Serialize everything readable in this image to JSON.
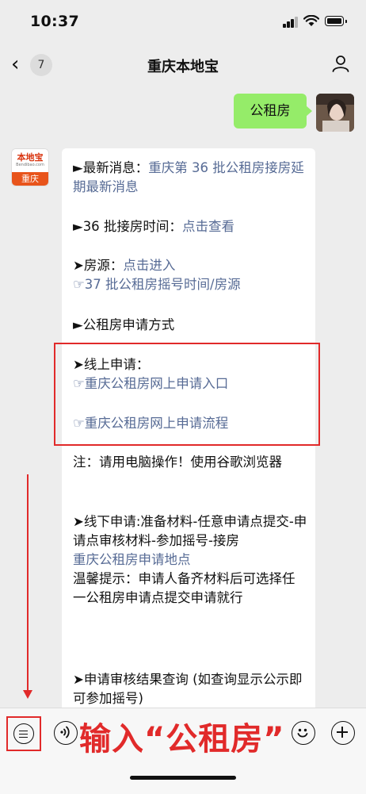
{
  "status": {
    "time": "10:37"
  },
  "nav": {
    "back_count": "7",
    "title": "重庆本地宝"
  },
  "outgoing": {
    "text": "公租房"
  },
  "bot_avatar": {
    "logo": "本地宝",
    "logo_domain": "Bendibao.com",
    "city": "重庆"
  },
  "message": {
    "p1_prefix": "►最新消息：",
    "p1_link": "重庆第 36 批公租房接房延期最新消息",
    "p2_prefix": "►36 批接房时间：",
    "p2_link": "点击查看",
    "p3_prefix": "➤房源：",
    "p3_link": "点击进入",
    "p3_link2": "☞37 批公租房摇号时间/房源",
    "p4": "►公租房申请方式",
    "p5_label": "➤线上申请：",
    "p5_link1": "☞重庆公租房网上申请入口",
    "p5_link2": "☞重庆公租房网上申请流程",
    "p6": "注：请用电脑操作！使用谷歌浏览器",
    "p7": "➤线下申请:准备材料-任意申请点提交-申请点审核材料-参加摇号-接房",
    "p7_link": "重庆公租房申请地点",
    "p7_tip": "温馨提示：申请人备齐材料后可选择任一公租房申请点提交申请就行",
    "p8": "➤申请审核结果查询 (如查询显示公示即可参加摇号)"
  },
  "bottom": {
    "caption": "输入“公租房”"
  },
  "colors": {
    "link": "#576b95",
    "bubble_out": "#95ec69",
    "annotation": "#e12a2a"
  }
}
